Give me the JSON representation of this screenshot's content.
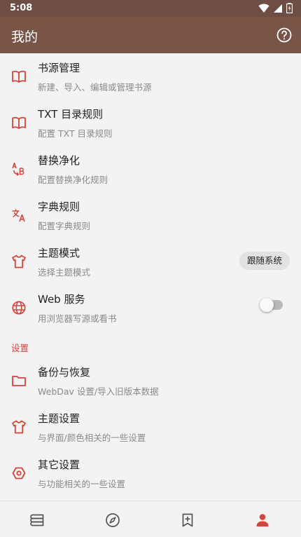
{
  "status_bar": {
    "time": "5:08",
    "icons": [
      "wifi-icon",
      "signal-icon",
      "battery-icon"
    ]
  },
  "app_bar": {
    "title": "我的",
    "help_icon": "help-circle-icon"
  },
  "items": [
    {
      "icon": "book-open-icon",
      "title": "书源管理",
      "subtitle": "新建、导入、编辑或管理书源"
    },
    {
      "icon": "book-open-icon",
      "title": "TXT 目录规则",
      "subtitle": "配置 TXT 目录规则"
    },
    {
      "icon": "find-replace-icon",
      "title": "替换净化",
      "subtitle": "配置替换净化规则"
    },
    {
      "icon": "translate-icon",
      "title": "字典规则",
      "subtitle": "配置字典规则"
    },
    {
      "icon": "tshirt-icon",
      "title": "主题模式",
      "subtitle": "选择主题模式",
      "chip": "跟随系统"
    },
    {
      "icon": "globe-icon",
      "title": "Web 服务",
      "subtitle": "用浏览器写源或看书",
      "toggle": false
    }
  ],
  "section": {
    "title": "设置"
  },
  "settings_items": [
    {
      "icon": "folder-icon",
      "title": "备份与恢复",
      "subtitle": "WebDav 设置/导入旧版本数据"
    },
    {
      "icon": "tshirt-icon",
      "title": "主题设置",
      "subtitle": "与界面/颜色相关的一些设置"
    },
    {
      "icon": "hexagon-settings-icon",
      "title": "其它设置",
      "subtitle": "与功能相关的一些设置"
    }
  ],
  "bottom_nav": [
    {
      "icon": "bookshelf-icon",
      "active": false
    },
    {
      "icon": "compass-icon",
      "active": false
    },
    {
      "icon": "bookmark-add-icon",
      "active": false
    },
    {
      "icon": "person-icon",
      "active": true
    }
  ],
  "colors": {
    "status_bar": "#6e4e44",
    "app_bar": "#795548",
    "accent": "#d5443a",
    "background": "#f3f3f3"
  }
}
